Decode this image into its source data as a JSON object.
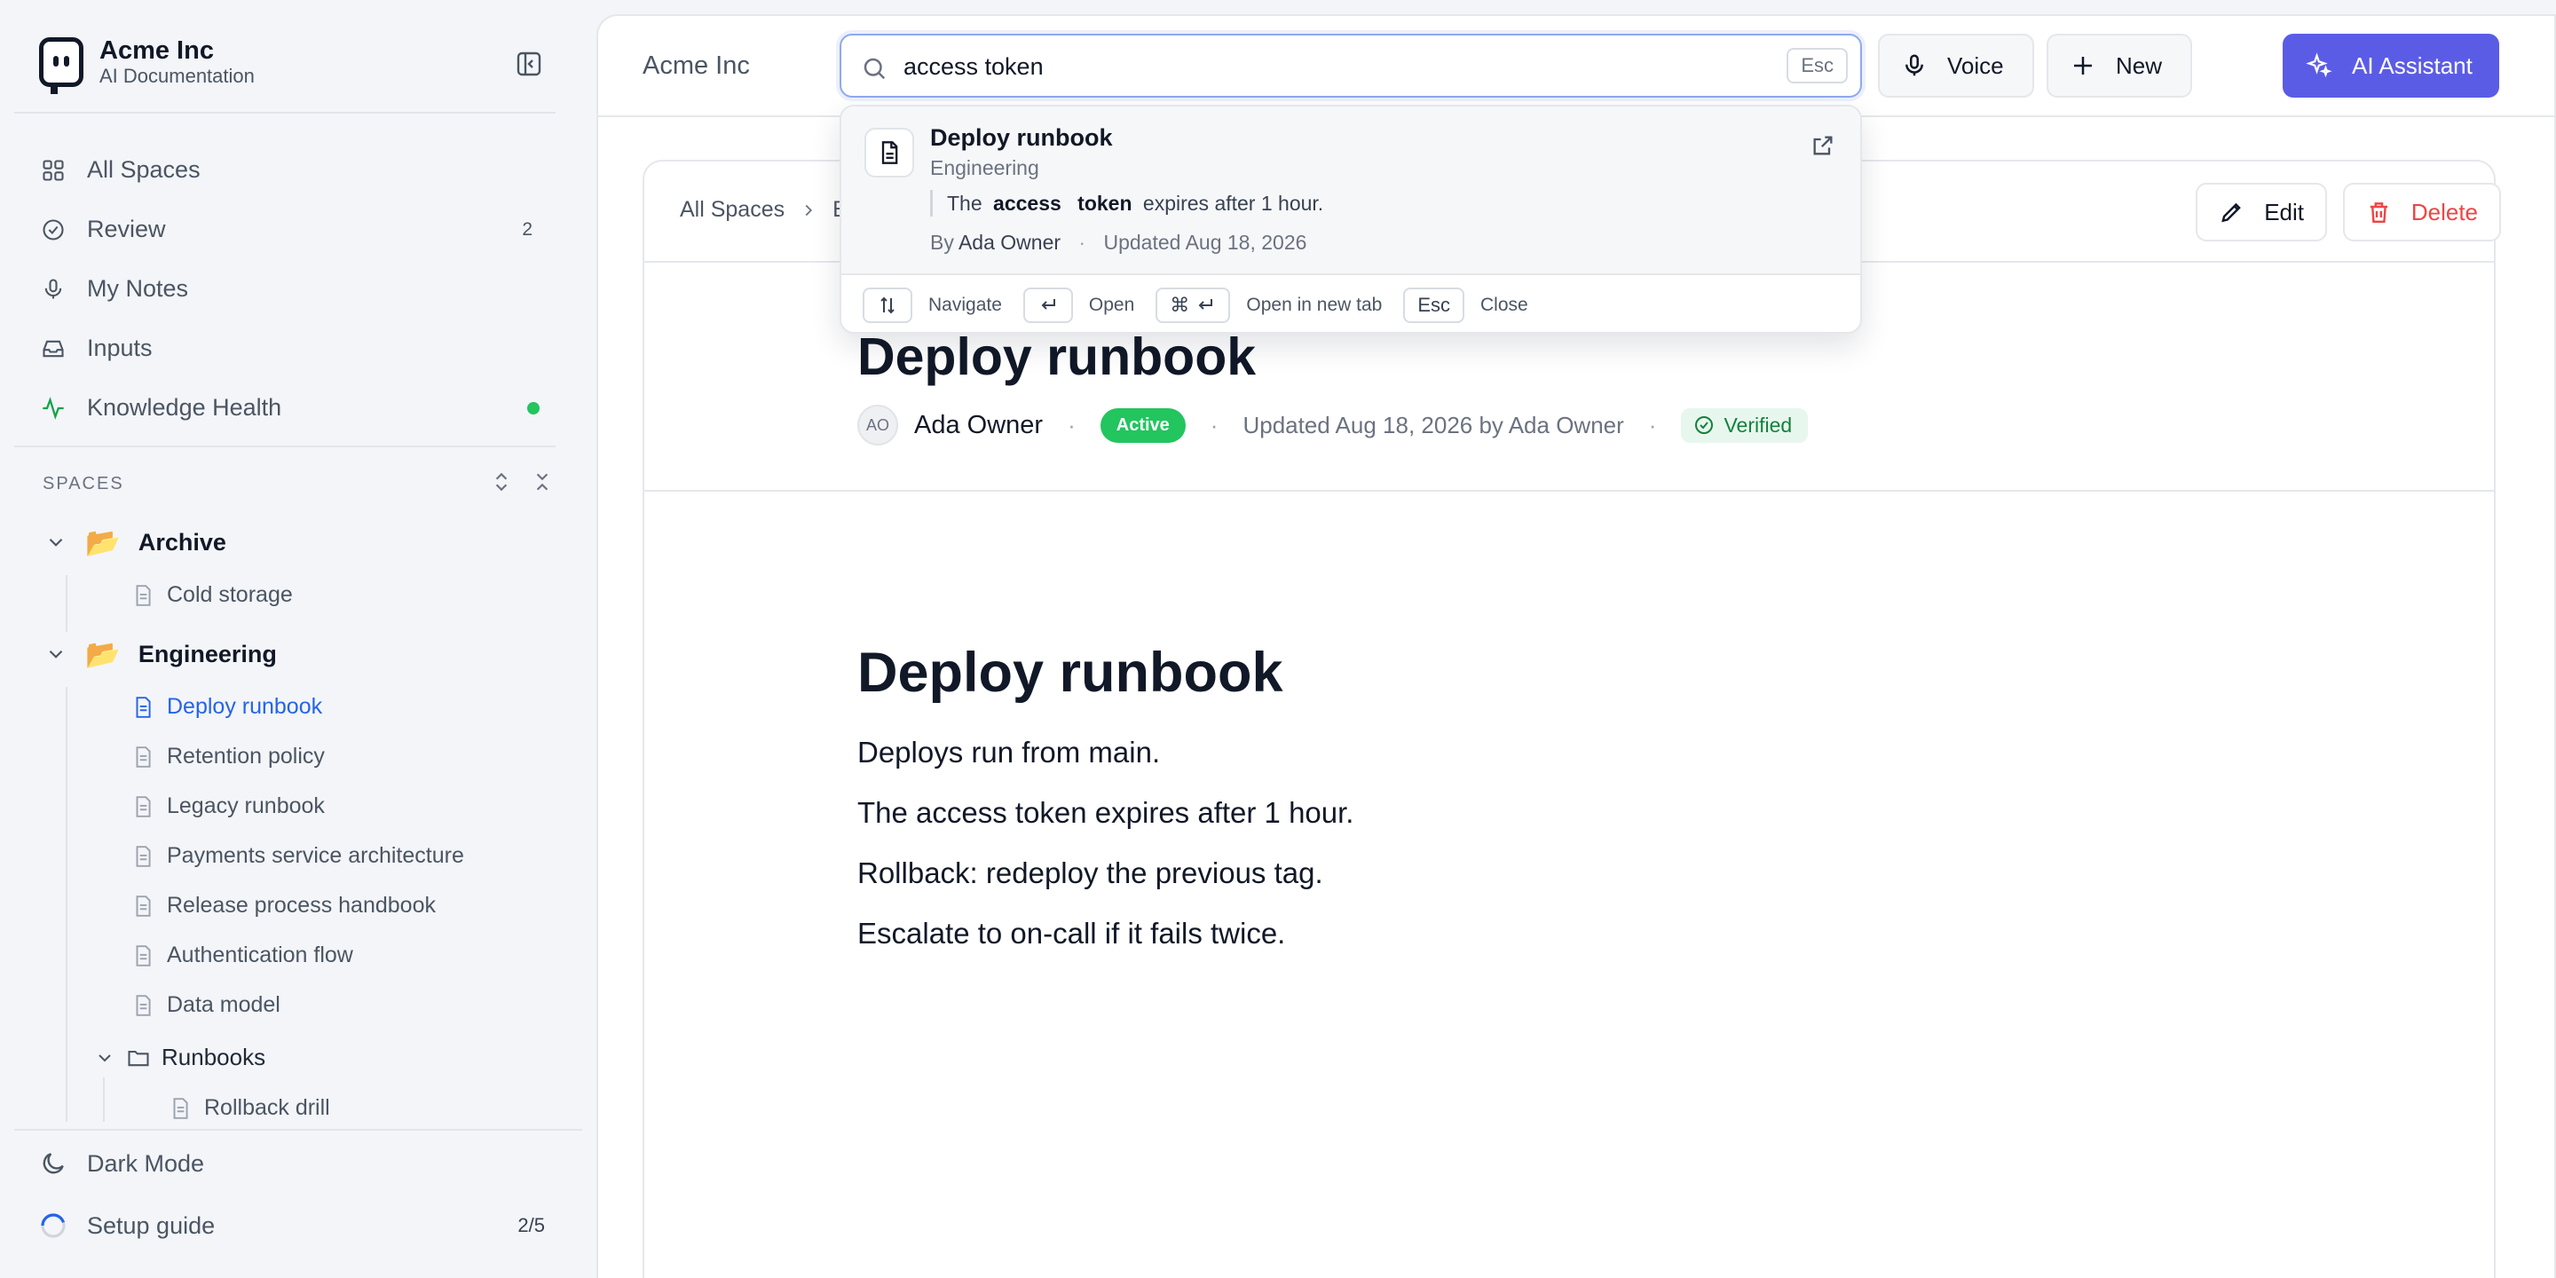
{
  "sidebar": {
    "brand": {
      "name": "Acme Inc",
      "subtitle": "AI Documentation"
    },
    "nav": [
      {
        "label": "All Spaces",
        "icon": "grid-icon"
      },
      {
        "label": "Review",
        "icon": "check-circle-icon",
        "count": "2"
      },
      {
        "label": "My Notes",
        "icon": "microphone-icon"
      },
      {
        "label": "Inputs",
        "icon": "inbox-icon"
      },
      {
        "label": "Knowledge Health",
        "icon": "activity-icon",
        "status_color": "#22c55e"
      }
    ],
    "spaces_label": "SPACES",
    "tree": {
      "archive": {
        "label": "Archive",
        "children": [
          "Cold storage"
        ]
      },
      "engineering": {
        "label": "Engineering",
        "children": [
          "Deploy runbook",
          "Retention policy",
          "Legacy runbook",
          "Payments service architecture",
          "Release process handbook",
          "Authentication flow",
          "Data model"
        ],
        "subfolder": {
          "label": "Runbooks",
          "children": [
            "Rollback drill"
          ]
        }
      }
    },
    "bottom": {
      "dark_mode": "Dark Mode",
      "setup_guide": "Setup guide",
      "setup_progress": "2/5"
    }
  },
  "topbar": {
    "workspace": "Acme Inc",
    "search": {
      "value": "access token",
      "shortcut": "Esc"
    },
    "voice_label": "Voice",
    "new_label": "New",
    "ai_label": "AI Assistant",
    "accent": "#5b5ce6"
  },
  "search_results": {
    "result": {
      "title": "Deploy runbook",
      "space": "Engineering",
      "snippet_pre": "The",
      "snippet_hit1": "access",
      "snippet_hit2": "token",
      "snippet_post": "expires after 1 hour.",
      "by_label": "By",
      "author": "Ada Owner",
      "updated": "Updated Aug 18, 2026"
    },
    "hints": {
      "navigate": "Navigate",
      "open": "Open",
      "open_new_tab": "Open in new tab",
      "esc_key": "Esc",
      "close": "Close"
    }
  },
  "document": {
    "breadcrumb": [
      "All Spaces",
      "E"
    ],
    "edit_label": "Edit",
    "delete_label": "Delete",
    "title": "Deploy runbook",
    "avatar_initials": "AO",
    "owner": "Ada Owner",
    "status": "Active",
    "updated": "Updated Aug 18, 2026 by Ada Owner",
    "verified": "Verified",
    "body": {
      "heading": "Deploy runbook",
      "paragraphs": [
        "Deploys run from main.",
        "The access token expires after 1 hour.",
        "Rollback: redeploy the previous tag.",
        "Escalate to on-call if it fails twice."
      ]
    }
  }
}
